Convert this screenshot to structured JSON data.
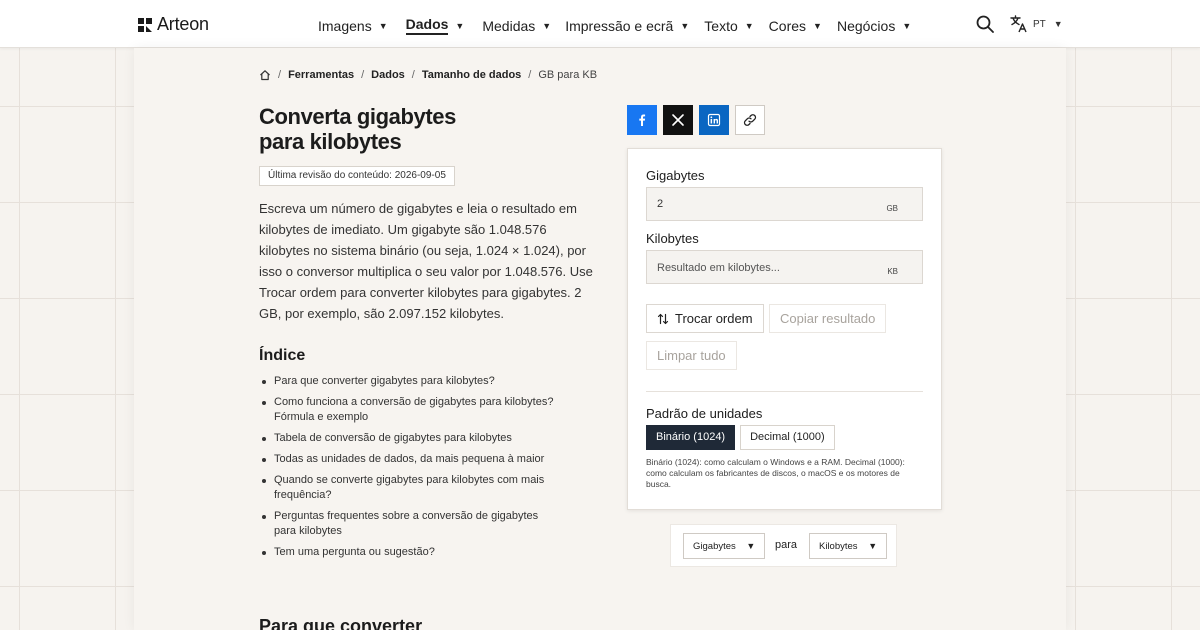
{
  "header": {
    "logo_text": "Arteon",
    "nav": [
      {
        "label": "Imagens",
        "active": false
      },
      {
        "label": "Dados",
        "active": true
      },
      {
        "label": "Medidas",
        "active": false
      },
      {
        "label": "Impressão e ecrã",
        "active": false
      },
      {
        "label": "Texto",
        "active": false
      },
      {
        "label": "Cores",
        "active": false
      },
      {
        "label": "Negócios",
        "active": false
      }
    ],
    "language": "PT"
  },
  "breadcrumb": {
    "items": [
      "Ferramentas",
      "Dados",
      "Tamanho de dados"
    ],
    "current": "GB para KB"
  },
  "article": {
    "title": "Converta gigabytes para kilobytes",
    "revision": "Última revisão do conteúdo: 2026-09-05",
    "intro": "Escreva um número de gigabytes e leia o resultado em kilobytes de imediato. Um gigabyte são 1.048.576 kilobytes no sistema binário (ou seja, 1.024 × 1.024), por isso o conversor multiplica o seu valor por 1.048.576. Use Trocar ordem para converter kilobytes para gigabytes. 2 GB, por exemplo, são 2.097.152 kilobytes.",
    "toc_title": "Índice",
    "toc": [
      "Para que converter gigabytes para kilobytes?",
      "Como funciona a conversão de gigabytes para kilobytes? Fórmula e exemplo",
      "Tabela de conversão de gigabytes para kilobytes",
      "Todas as unidades de dados, da mais pequena à maior",
      "Quando se converte gigabytes para kilobytes com mais frequência?",
      "Perguntas frequentes sobre a conversão de gigabytes para kilobytes",
      "Tem uma pergunta ou sugestão?"
    ],
    "next_heading": "Para que converter"
  },
  "converter": {
    "from_label": "Gigabytes",
    "from_value": "2",
    "from_unit": "GB",
    "to_label": "Kilobytes",
    "to_placeholder": "Resultado em kilobytes...",
    "to_unit": "KB",
    "swap_label": "Trocar ordem",
    "copy_label": "Copiar resultado",
    "clear_label": "Limpar tudo",
    "standard_label": "Padrão de unidades",
    "standards": [
      {
        "label": "Binário (1024)",
        "active": true
      },
      {
        "label": "Decimal (1000)",
        "active": false
      }
    ],
    "standard_note": "Binário (1024): como calculam o Windows e a RAM. Decimal (1000): como calculam os fabricantes de discos, o macOS e os motores de busca."
  },
  "unit_picker": {
    "from": "Gigabytes",
    "joiner": "para",
    "to": "Kilobytes"
  },
  "colors": {
    "facebook": "#1877f2",
    "x": "#111111",
    "linkedin": "#0a66c2",
    "active_segment": "#1f2937"
  },
  "icons": [
    "home-icon",
    "search-icon",
    "translate-icon",
    "facebook-icon",
    "x-icon",
    "linkedin-icon",
    "link-icon",
    "swap-icon"
  ]
}
